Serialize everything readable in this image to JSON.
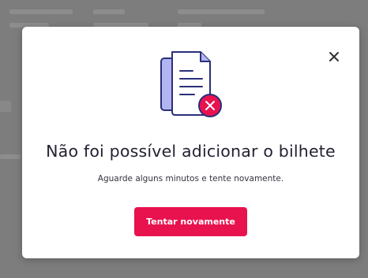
{
  "modal": {
    "title": "Não foi possível adicionar o bilhete",
    "message": "Aguarde alguns minutos e tente novamente.",
    "retry_label": "Tentar novamente",
    "close_icon": "close-icon",
    "illustration_icon": "document-error-icon"
  },
  "colors": {
    "accent": "#e8124f",
    "illustration_fill": "#b3b5f0",
    "illustration_stroke": "#2a2f7a",
    "overlay": "#7d7d7d"
  }
}
